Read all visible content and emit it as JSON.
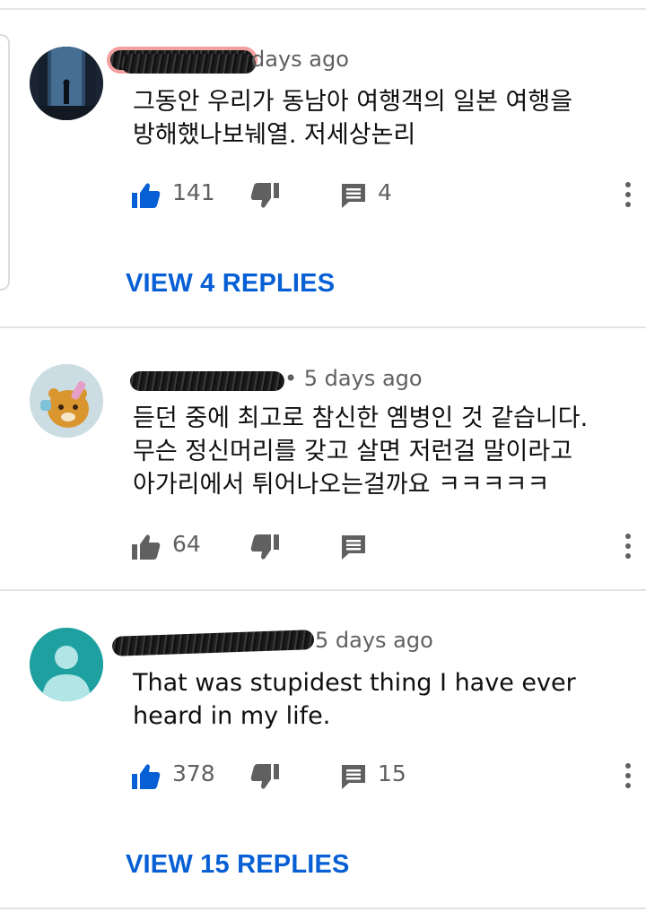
{
  "comments": [
    {
      "time": "days ago",
      "text_lines": [
        "그동안 우리가 동남아 여행객의 일본 여행을",
        "방해했나보눼열. 저세상논리"
      ],
      "likes": "141",
      "replies_count": "4",
      "view_replies": "VIEW 4 REPLIES",
      "author_redacted": true
    },
    {
      "time": "• 5 days ago",
      "text_lines": [
        "듣던 중에 최고로 참신한 옘병인 것 같습니다.",
        "무슨 정신머리를 갖고 살면 저런걸 말이라고",
        "아가리에서 튀어나오는걸까요 ㅋㅋㅋㅋㅋ"
      ],
      "likes": "64",
      "replies_count": "",
      "author_redacted": true
    },
    {
      "time": "5 days ago",
      "text_lines": [
        "That was stupidest thing I have ever",
        "heard in my life."
      ],
      "likes": "378",
      "replies_count": "15",
      "view_replies": "VIEW 15 REPLIES",
      "author_redacted": true
    }
  ],
  "colors": {
    "link": "#065fd4",
    "meta": "#606060",
    "text": "#0f0f0f",
    "liked": "#065fd4"
  },
  "icons": [
    "thumbs-up-icon",
    "thumbs-down-icon",
    "reply-icon",
    "more-vert-icon"
  ]
}
